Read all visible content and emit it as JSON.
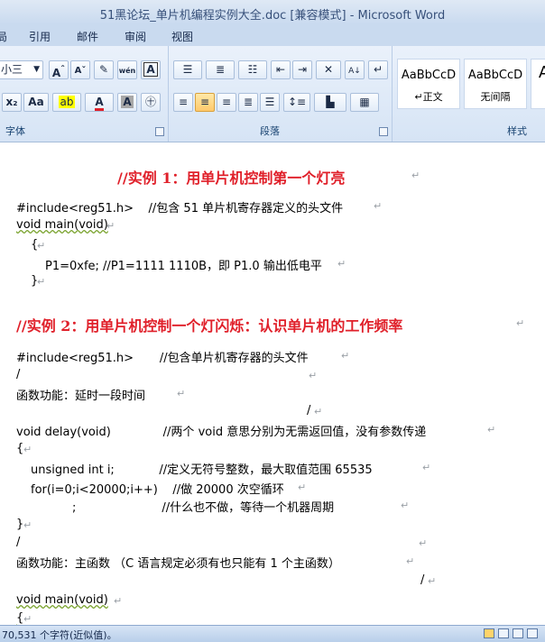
{
  "window": {
    "title": "51黑论坛_单片机编程实例大全.doc [兼容模式] - Microsoft Word"
  },
  "tabs": [
    "局",
    "引用",
    "邮件",
    "审阅",
    "视图"
  ],
  "ribbon": {
    "font_size": "小三",
    "groups": {
      "font": "字体",
      "paragraph": "段落",
      "styles": "样式"
    },
    "styles": [
      {
        "sample": "AaBbCcD",
        "name": "↵正文"
      },
      {
        "sample": "AaBbCcD",
        "name": "无间隔"
      },
      {
        "sample": "A",
        "name": ""
      }
    ]
  },
  "document": {
    "lines": [
      {
        "text": "//实例 1：用单片机控制第一个灯亮",
        "heading": true
      },
      {
        "text": "#include<reg51.h>    //包含 51 单片机寄存器定义的头文件"
      },
      {
        "text": "void main(void)"
      },
      {
        "text": "{"
      },
      {
        "text": "P1=0xfe; //P1=1111 1110B，即 P1.0 输出低电平"
      },
      {
        "text": "}"
      },
      {
        "text": "//实例 2：用单片机控制一个灯闪烁：认识单片机的工作频率",
        "heading": true
      },
      {
        "text": "#include<reg51.h>       //包含单片机寄存器的头文件"
      },
      {
        "text": "/"
      },
      {
        "text": "函数功能：延时一段时间"
      },
      {
        "text": "/"
      },
      {
        "text": "void delay(void)              //两个 void 意思分别为无需返回值，没有参数传递"
      },
      {
        "text": "{"
      },
      {
        "text": "unsigned int i;            //定义无符号整数，最大取值范围 65535"
      },
      {
        "text": "for(i=0;i<20000;i++)    //做 20000 次空循环"
      },
      {
        "text": ";                       //什么也不做，等待一个机器周期"
      },
      {
        "text": "}"
      },
      {
        "text": "/"
      },
      {
        "text": "函数功能：主函数 （C 语言规定必须有也只能有 1 个主函数）"
      },
      {
        "text": "/"
      },
      {
        "text": "void main(void)"
      },
      {
        "text": "{"
      }
    ]
  },
  "status": {
    "word_count": "70,531 个字符(近似值)。"
  }
}
